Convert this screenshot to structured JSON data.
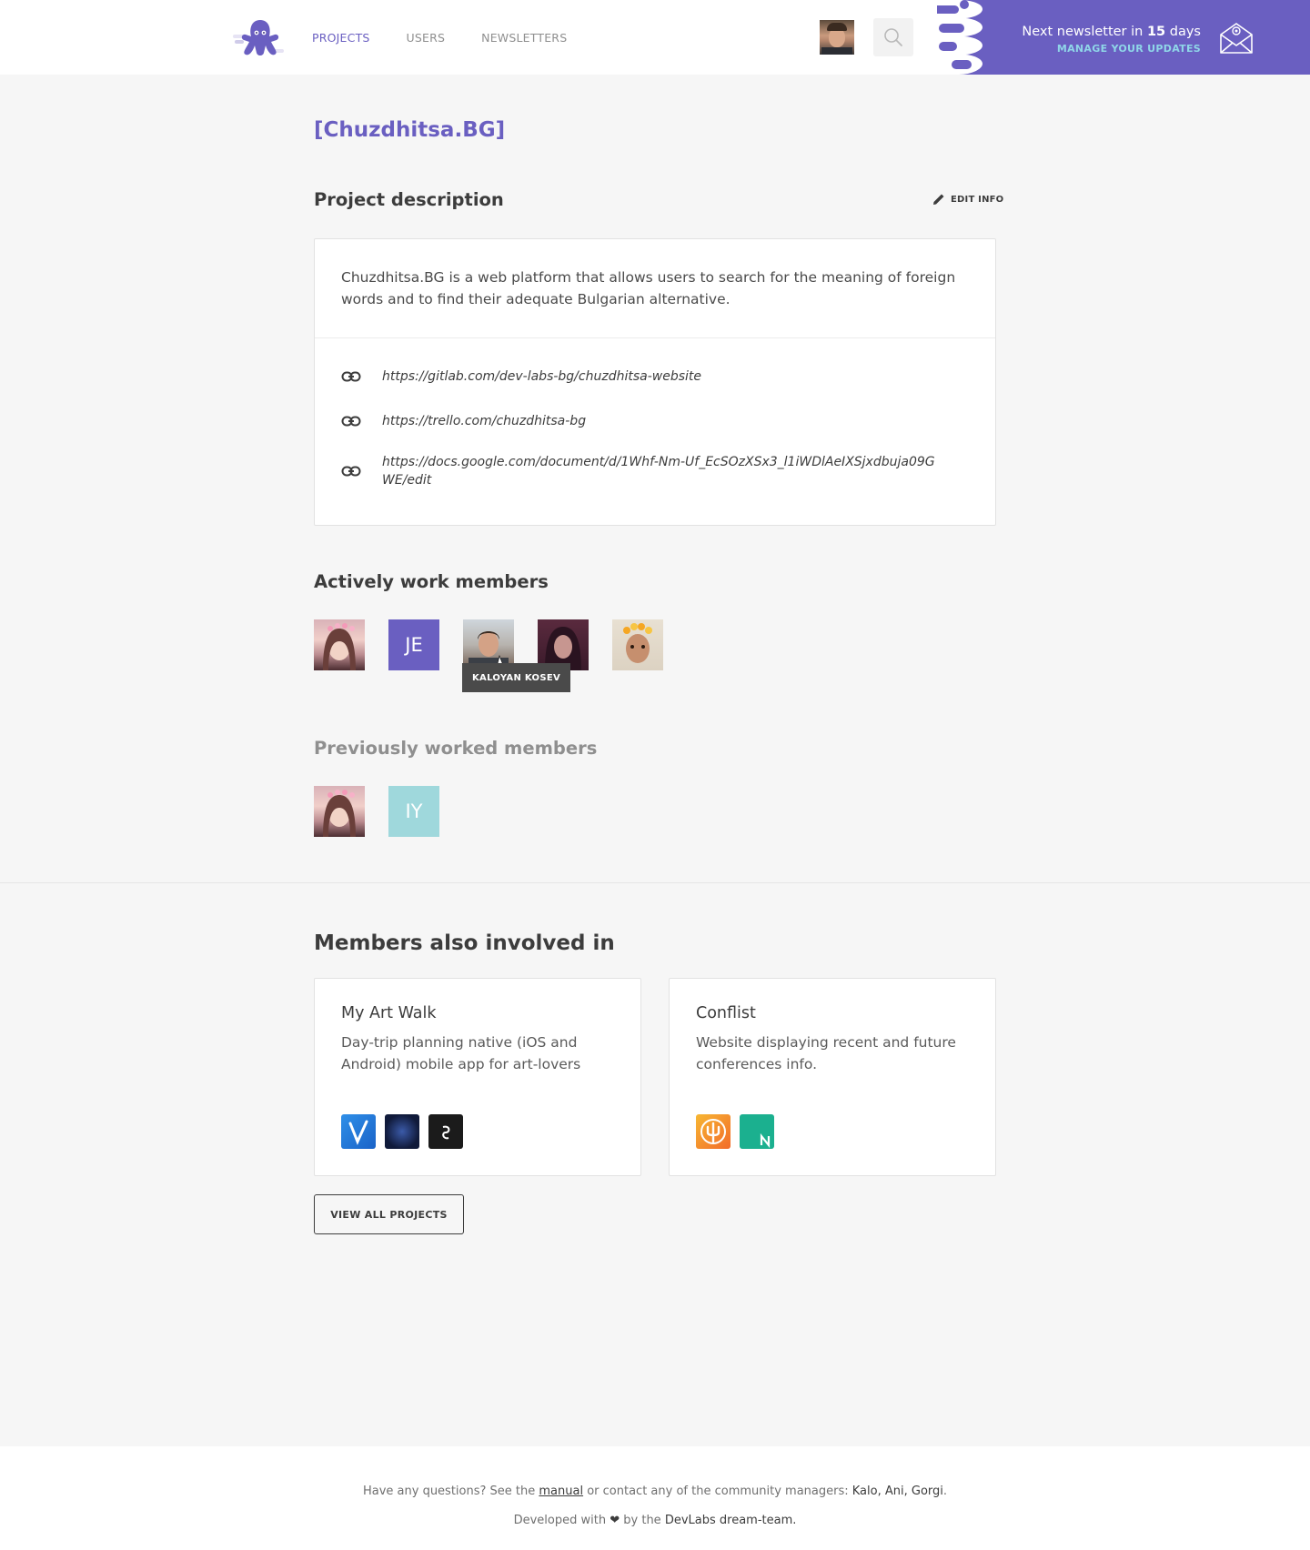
{
  "header": {
    "logo_icon": "octopus-logo-icon",
    "nav": [
      {
        "label": "PROJECTS",
        "active": true
      },
      {
        "label": "USERS",
        "active": false
      },
      {
        "label": "NEWSLETTERS",
        "active": false
      }
    ],
    "search_icon": "search-icon",
    "newsletter": {
      "prefix": "Next newsletter in",
      "count": "15",
      "suffix": "days",
      "link": "MANAGE YOUR UPDATES",
      "icon": "envelope-icon"
    }
  },
  "project": {
    "title": "[Chuzdhitsa.BG]",
    "description_heading": "Project description",
    "edit_label": "EDIT INFO",
    "description": "Chuzdhitsa.BG is a web platform that allows users to search for the meaning of foreign words and to find their adequate Bulgarian alternative.",
    "links": [
      "https://gitlab.com/dev-labs-bg/chuzdhitsa-website",
      "https://trello.com/chuzdhitsa-bg",
      "https://docs.google.com/document/d/1Whf-Nm-Uf_EcSOzXSx3_l1iWDlAeIXSjxdbuja09GWE/edit"
    ]
  },
  "active_members": {
    "heading": "Actively work members",
    "members": [
      {
        "type": "photo"
      },
      {
        "type": "initials",
        "initials": "JE",
        "color": "#6a5fc1"
      },
      {
        "type": "photo"
      },
      {
        "type": "photo"
      },
      {
        "type": "photo"
      }
    ],
    "tooltip": "KALOYAN KOSEV"
  },
  "previous_members": {
    "heading": "Previously worked members",
    "members": [
      {
        "type": "photo"
      },
      {
        "type": "initials",
        "initials": "IY",
        "color": "#9fd8dc"
      }
    ]
  },
  "involved": {
    "heading": "Members also involved in",
    "projects": [
      {
        "title": "My Art Walk",
        "description": "Day-trip planning native (iOS and Android) mobile app for art-lovers"
      },
      {
        "title": "Conflist",
        "description": "Website displaying recent and future conferences info."
      }
    ],
    "view_all": "VIEW ALL PROJECTS"
  },
  "footer": {
    "q_prefix": "Have any questions? See the",
    "manual": "manual",
    "q_middle": "or contact any of the community managers:",
    "managers": "Kalo, Ani, Gorgi",
    "q_end": ".",
    "dev_prefix": "Developed with",
    "heart": "❤",
    "dev_middle": "by the",
    "team": "DevLabs dream-team."
  },
  "colors": {
    "accent": "#6a5fc1",
    "newsletter_link": "#8fd6e8"
  }
}
